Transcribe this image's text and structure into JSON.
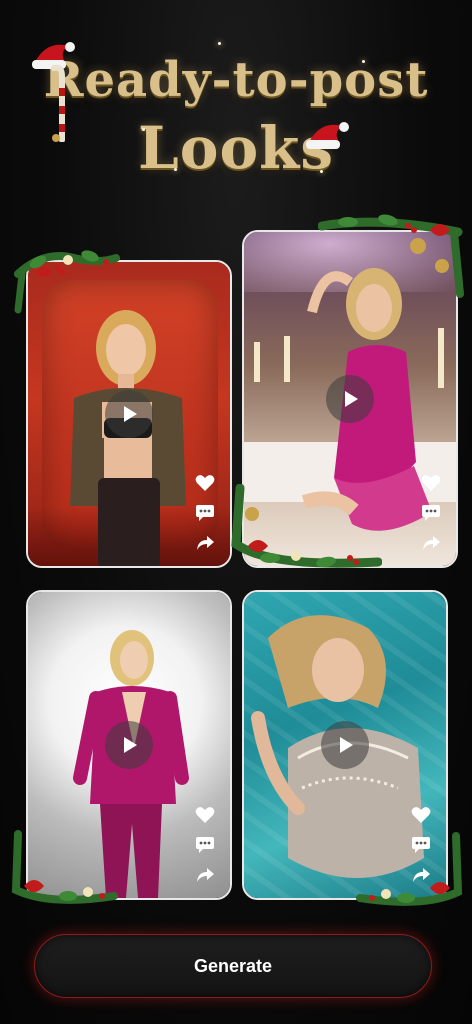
{
  "header": {
    "title_line1": "Ready-to-post",
    "title_line2": "Looks"
  },
  "cards": [
    {
      "name": "red-chair-look"
    },
    {
      "name": "pink-sequin-look"
    },
    {
      "name": "magenta-suit-look"
    },
    {
      "name": "pool-crystal-look"
    }
  ],
  "icons": {
    "play": "play-icon",
    "like": "heart-icon",
    "comment": "comment-icon",
    "share": "share-icon"
  },
  "actions": {
    "generate_label": "Generate"
  },
  "colors": {
    "background": "#0b0b0b",
    "title_gold": "#d9c08a",
    "button_glow": "#8a1c1c",
    "card_border": "#e8e8e8"
  }
}
